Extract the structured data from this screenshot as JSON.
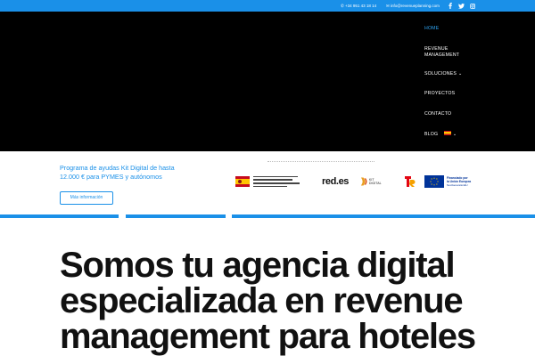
{
  "topbar": {
    "phone": "+34 951 43 18 14",
    "email": "info@revenueplanning.com",
    "phone_icon": "phone-icon",
    "email_icon": "envelope-icon",
    "social": [
      "facebook-icon",
      "twitter-icon",
      "instagram-icon"
    ]
  },
  "nav": {
    "items": [
      {
        "label": "HOME",
        "active": true
      },
      {
        "label": "REVENUE",
        "label2": "MANAGEMENT"
      },
      {
        "label": "SOLUCIONES",
        "has_dropdown": true
      },
      {
        "label": "PROYECTOS"
      },
      {
        "label": "CONTACTO"
      },
      {
        "label": "BLOG",
        "flag": "spain-flag-icon",
        "has_dropdown": true
      }
    ]
  },
  "promo": {
    "text": "Programa de ayudas Kit Digital de hasta 12.000 € para PYMES y autónomos",
    "button": "Más información",
    "logos": {
      "reds": "red.es",
      "kit": "KIT DIGITAL",
      "eu_line1": "Financiado por",
      "eu_line2": "la Unión Europea",
      "eu_line3": "NextGenerationEU"
    }
  },
  "hero": {
    "line1": "Somos tu agencia digital",
    "line2": "especializada en revenue",
    "line3": "management para hoteles"
  },
  "colors": {
    "accent": "#1a90e8",
    "header_bg": "#000000",
    "nav_active": "#2ea3f2",
    "hero_text": "#111111"
  }
}
